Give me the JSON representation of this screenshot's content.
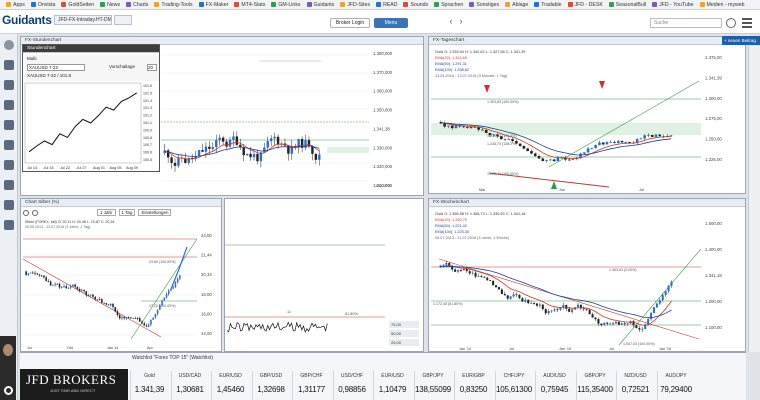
{
  "bookmarks": [
    "Apps",
    "Onvista",
    "GoldSeiten",
    "News",
    "Charts",
    "Trading-Tools",
    "FX-Maker",
    "MT4-Stats",
    "GM-Links",
    "Guidants",
    "JFD-Sites",
    "READ",
    "Sounds",
    "Sprachen",
    "Sonstiges",
    "Ablage",
    "Tradable",
    "JFD - DESK",
    "SeasonalBull",
    "JFD - YouTube",
    "Medien - myweb"
  ],
  "app": {
    "logo": "Guidants",
    "tab_label": "JFD-FX-Intraday.HT-DM",
    "btn_login": "Broker Login",
    "btn_menu": "Menu",
    "search_placeholder": "Suche",
    "new_post": "+ neuen Beitrag"
  },
  "panels": {
    "mini": {
      "title": "Stundenchart",
      "label_a": "Multi",
      "symbol": "XAUUSD 7-22",
      "prevclose_label": "Vorschaltage",
      "prevclose_value": "20",
      "ticker": "XAUUSD 7-22 / 101.8",
      "xlabels": [
        "Jul 14",
        "Jul 18",
        "Jul 22",
        "Jul 27",
        "Aug 01",
        "Aug 05",
        "Aug 09"
      ],
      "ylabels": [
        "101.6",
        "101.5",
        "101.4",
        "101.3",
        "101.2",
        "101.1",
        "100.9",
        "100.8",
        "100.7",
        "100.6",
        "100.5"
      ]
    },
    "top_left": {
      "title": "FX-Stundenchart",
      "ylabels": [
        "1.380,000",
        "1.370,000",
        "1.360,000",
        "1.350,000",
        "1.341,38",
        "1.330,000",
        "1.320,000",
        "1.310,000"
      ],
      "fib_label": "100.00%"
    },
    "silver": {
      "title": "Chart Silber (%)",
      "legend": "Silber (FOREX, bid) O: 20,11 H: 20,48 L: 19,87 C: 20,34",
      "range": "20.05.2013 - 13.07.2016 (3 Jahre, 1 Tag)",
      "ylabels": [
        "24,00",
        "21,44",
        "20,34",
        "18,00",
        "16,00",
        "14,00"
      ],
      "xlabels": [
        "Jul",
        "Okt",
        "Jan 14",
        "Apr"
      ],
      "fib_a": "23.60 (100.00%)",
      "fib_b": "17.20 (100.00%)",
      "btn_1j": "1 Jahr",
      "btn_1t": "1 Tag",
      "btn_ein": "Einstellungen",
      "osc_label": "11",
      "osc_ylabels": [
        "75,00",
        "50,00",
        "25,00"
      ],
      "osc_pct": "61.80%"
    },
    "gold_daily": {
      "title": "FX-Tageschart",
      "legend_gold": "Gold O: 1.333,04 H: 1.342,62 L: 1.327,58 C: 1.341,39",
      "ema20": "EMA(20): 1.324,69",
      "ema50": "EMA(50): 1.291,31",
      "ema100": "EMA(100): 1.258,82",
      "range": "13.04.2016 - 13.07.2016 (3 Monate, 1 Tag)",
      "ylabels": [
        "1.375,00",
        "1.341,39",
        "1.300,00",
        "1.275,00",
        "1.250,00",
        "1.225,00"
      ],
      "xlabels": [
        "Mai",
        "Jun",
        "Jul"
      ],
      "fib_1": "1.303,83 (100.00%)",
      "fib_2": "1.279,83 (123.6%)",
      "fib_3": "1.248,73 (138.2%)",
      "fib_4": "1.225,43 (100.00%)"
    },
    "gold_weekly": {
      "title": "FX-Wochenchart",
      "legend_gold": "Gold O: 1.368,58 H: 1.368,73 L: 1.330,53 C: 1.341,18",
      "ema20": "EMA(20): 1.269,79",
      "ema50": "EMA(50): 1.221,42",
      "ema100": "EMA(100): 1.225,30",
      "range": "08.07.2013 - 11.07.2016 (3 Jahre, 1 Woche)",
      "ylabels": [
        "1.500,00",
        "1.400,00",
        "1.341,18",
        "1.200,00",
        "1.100,00"
      ],
      "xlabels": [
        "Jan '14",
        "Jul",
        "Jan '15",
        "Jul",
        "Jan '16"
      ],
      "fib_1": "1.363,63 (0.00%)",
      "fib_2": "1.172,45 (61.80%)",
      "fib_3": "1.047,03 (100.00%)"
    }
  },
  "watchlist": {
    "header": "Watchlist \"Forex TOP 15\" (Watchlist)",
    "broker": "JFD BROKERS",
    "broker_tag": "JUST FAIR AND DIRECT",
    "items": [
      {
        "sym": "Gold",
        "val": "1.341,39",
        "color": "#111111"
      },
      {
        "sym": "USD/CAD",
        "val": "1,30681",
        "color": "#111111"
      },
      {
        "sym": "EUR/USD",
        "val": "1,45460",
        "color": "#111111"
      },
      {
        "sym": "GBP/USD",
        "val": "1,32698",
        "color": "#111111"
      },
      {
        "sym": "GBP/CHF",
        "val": "1,31177",
        "color": "#111111"
      },
      {
        "sym": "USD/CHF",
        "val": "0,98856",
        "color": "#111111"
      },
      {
        "sym": "EUR/USD",
        "val": "1,10479",
        "color": "#111111"
      },
      {
        "sym": "GBP/JPY",
        "val": "138,55099",
        "color": "#111111"
      },
      {
        "sym": "EUR/GBP",
        "val": "0,83250",
        "color": "#111111"
      },
      {
        "sym": "CHF/JPY",
        "val": "105,61300",
        "color": "#111111"
      },
      {
        "sym": "AUD/USD",
        "val": "0,75945",
        "color": "#111111"
      },
      {
        "sym": "GBP/JPY",
        "val": "115,35400",
        "color": "#111111"
      },
      {
        "sym": "NZD/USD",
        "val": "0,72521",
        "color": "#111111"
      },
      {
        "sym": "AUD/JPY",
        "val": "79,29400",
        "color": "#111111"
      }
    ]
  }
}
